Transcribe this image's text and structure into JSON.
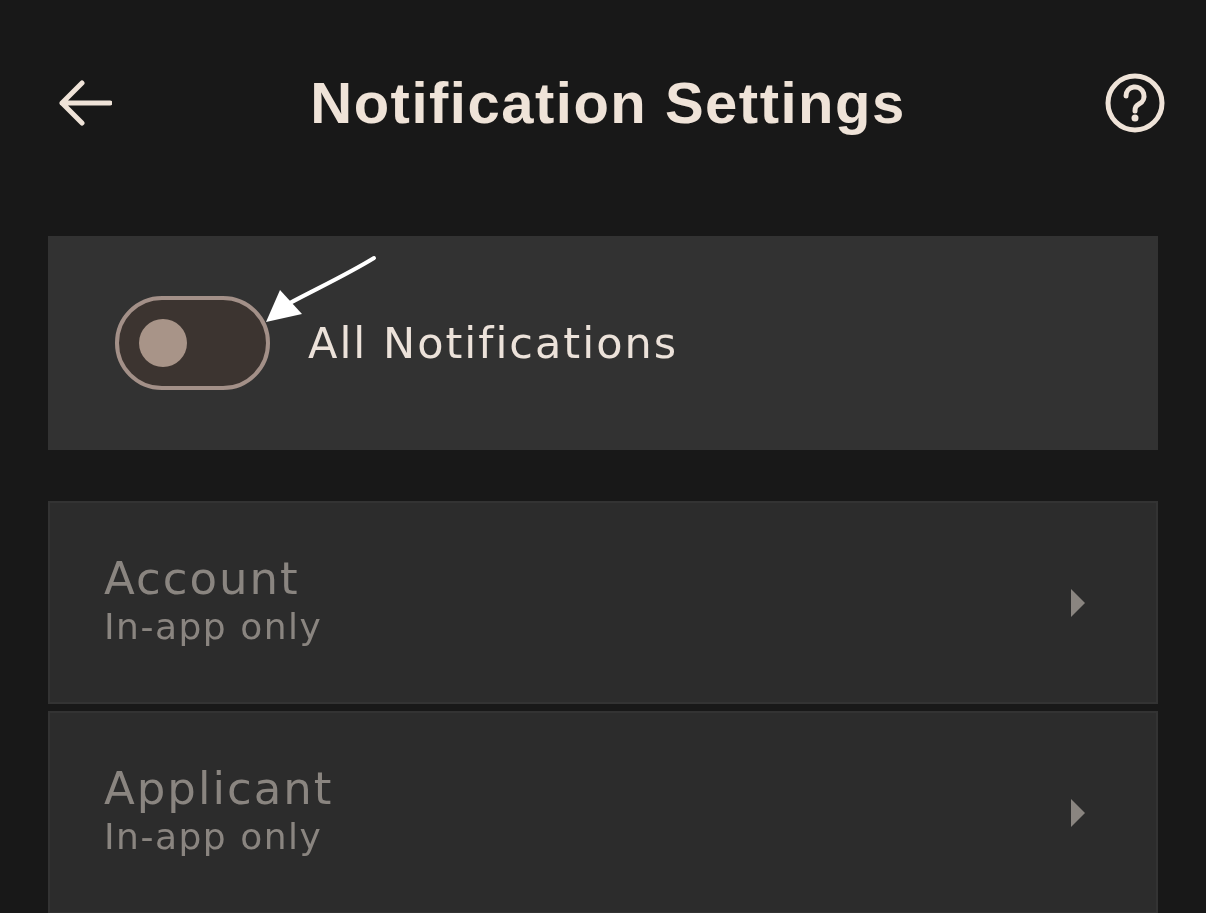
{
  "header": {
    "title": "Notification Settings"
  },
  "master_toggle": {
    "label": "All Notifications",
    "on": false
  },
  "categories": [
    {
      "title": "Account",
      "subtitle": "In-app only",
      "disabled": true
    },
    {
      "title": "Applicant",
      "subtitle": "In-app only",
      "disabled": true
    }
  ]
}
